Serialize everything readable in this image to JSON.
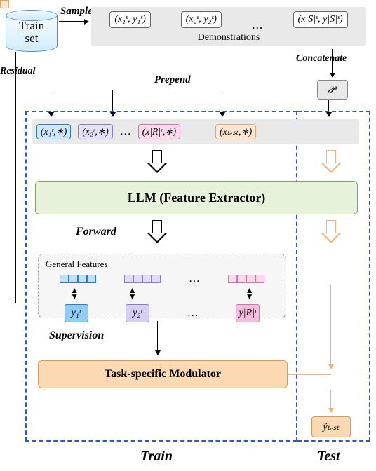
{
  "trainset_label": "Train\nset",
  "arrows": {
    "sample": "Sample",
    "concatenate": "Concatenate",
    "prepend": "Prepend",
    "residual": "Residual",
    "forward": "Forward",
    "supervision": "Supervision"
  },
  "demos": {
    "label": "Demonstrations",
    "items": [
      "(x₁ˢ, y₁ˢ)",
      "(x₂ˢ, y₂ˢ)",
      "⋯",
      "(x|S|ˢ, y|S|ˢ)"
    ]
  },
  "ps_symbol": "𝒫ˢ",
  "inputs": {
    "residual": [
      "(x₁ʳ,∗)",
      "(x₂ʳ,∗)",
      "…",
      "(x|R|ʳ,∗)"
    ],
    "test": "(xₜₑₛₜ,∗)"
  },
  "llm_label": "LLM (Feature Extractor)",
  "features_label": "General Features",
  "y_labels": [
    "y₁ʳ",
    "y₂ʳ",
    "…",
    "y|R|ʳ"
  ],
  "modulator_label": "Task-specific Modulator",
  "yhat_label": "ŷₜₑₛₜ",
  "regions": {
    "train": "Train",
    "test": "Test"
  }
}
